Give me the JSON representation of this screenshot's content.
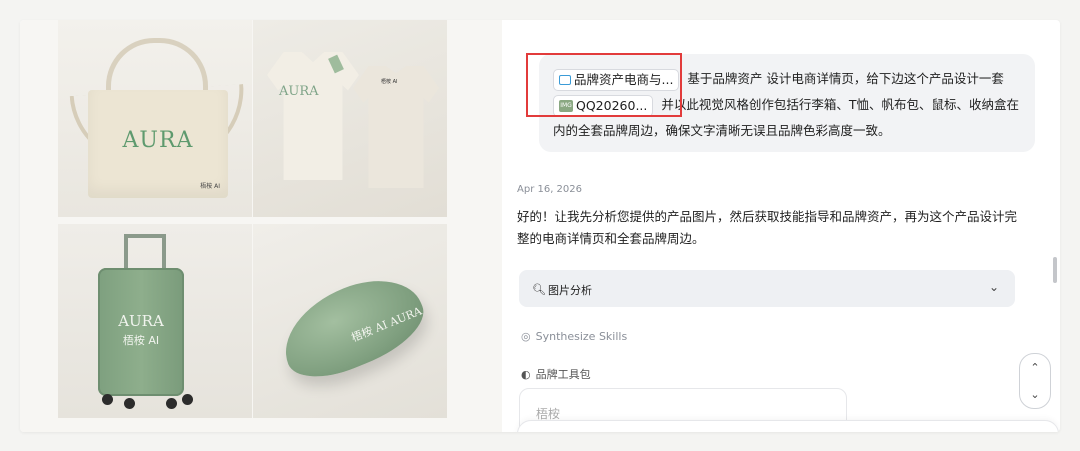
{
  "gallery": {
    "tote": {
      "brand": "AURA",
      "sub": "梧桉 AI"
    },
    "shirt": {
      "brand": "AURA",
      "sub": "梧桉 AI"
    },
    "suitcase": {
      "brand": "AURA",
      "sub": "梧桉 AI"
    },
    "mouse": {
      "brand": "梧桉 AI AURA"
    }
  },
  "message": {
    "chip1": "品牌资产电商与...",
    "text1": " 基于品牌资产  设计电商详情页，给下边这个产品设计一套",
    "chip2": "QQ20260...",
    "chip2_thumb": "IMG",
    "text2": " 并以此视觉风格创作包括行李箱、T恤、帆布包、鼠标、收纳盒在内的全套品牌周边，确保文字清晰无误且品牌色彩高度一致。"
  },
  "reply": {
    "date": "Apr 16, 2026",
    "text": "好的！让我先分析您提供的产品图片，然后获取技能指导和品牌资产，再为这个产品设计完整的电商详情页和全套品牌周边。"
  },
  "accordion": {
    "icon": "search-icon",
    "label": "图片分析",
    "chevron": "⌄"
  },
  "steps": {
    "synthesize_icon": "◎",
    "synthesize": "Synthesize Skills",
    "tools_icon": "◐",
    "tools": "品牌工具包"
  },
  "input": {
    "text": "梧桉"
  },
  "scroll": {
    "up": "⌃",
    "down": "⌄"
  },
  "colors": {
    "highlight": "#e23b3b",
    "brand_green": "#7ea07f"
  }
}
